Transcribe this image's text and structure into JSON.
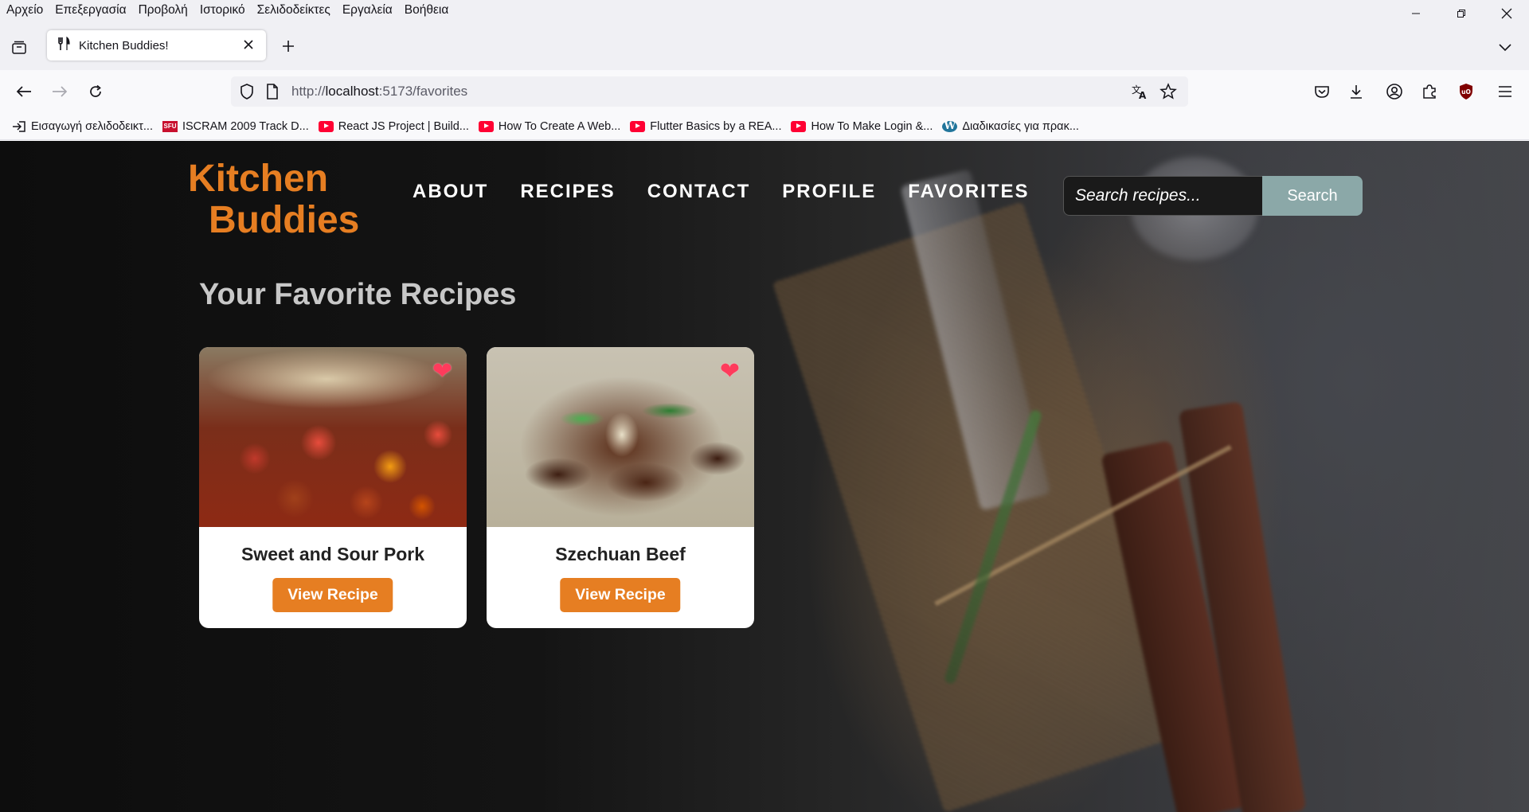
{
  "menubar": {
    "items": [
      "Αρχείο",
      "Επεξεργασία",
      "Προβολή",
      "Ιστορικό",
      "Σελιδοδείκτες",
      "Εργαλεία",
      "Βοήθεια"
    ]
  },
  "tab": {
    "title": "Kitchen Buddies!",
    "favicon": "fork-knife-icon"
  },
  "url": {
    "scheme": "http://",
    "host": "localhost",
    "rest": ":5173/favorites"
  },
  "bookmarks": [
    {
      "label": "Εισαγωγή σελιδοδεικτ...",
      "icon": "import-icon"
    },
    {
      "label": "ISCRAM 2009 Track D...",
      "icon": "sfu-icon"
    },
    {
      "label": "React JS Project | Build...",
      "icon": "youtube-icon"
    },
    {
      "label": "How To Create A Web...",
      "icon": "youtube-icon"
    },
    {
      "label": "Flutter Basics by a REA...",
      "icon": "youtube-icon"
    },
    {
      "label": "How To Make Login &...",
      "icon": "youtube-icon"
    },
    {
      "label": "Διαδικασίες για πρακ...",
      "icon": "wordpress-icon"
    }
  ],
  "site": {
    "logo_line1": "Kitchen",
    "logo_line2": "Buddies",
    "nav": [
      "ABOUT",
      "RECIPES",
      "CONTACT",
      "PROFILE",
      "FAVORITES"
    ],
    "search_placeholder": "Search recipes...",
    "search_button": "Search",
    "page_title": "Your Favorite Recipes",
    "accent_color": "#e67e22"
  },
  "favorites": [
    {
      "name": "Sweet and Sour Pork",
      "button": "View Recipe",
      "favorited": true
    },
    {
      "name": "Szechuan Beef",
      "button": "View Recipe",
      "favorited": true
    }
  ]
}
